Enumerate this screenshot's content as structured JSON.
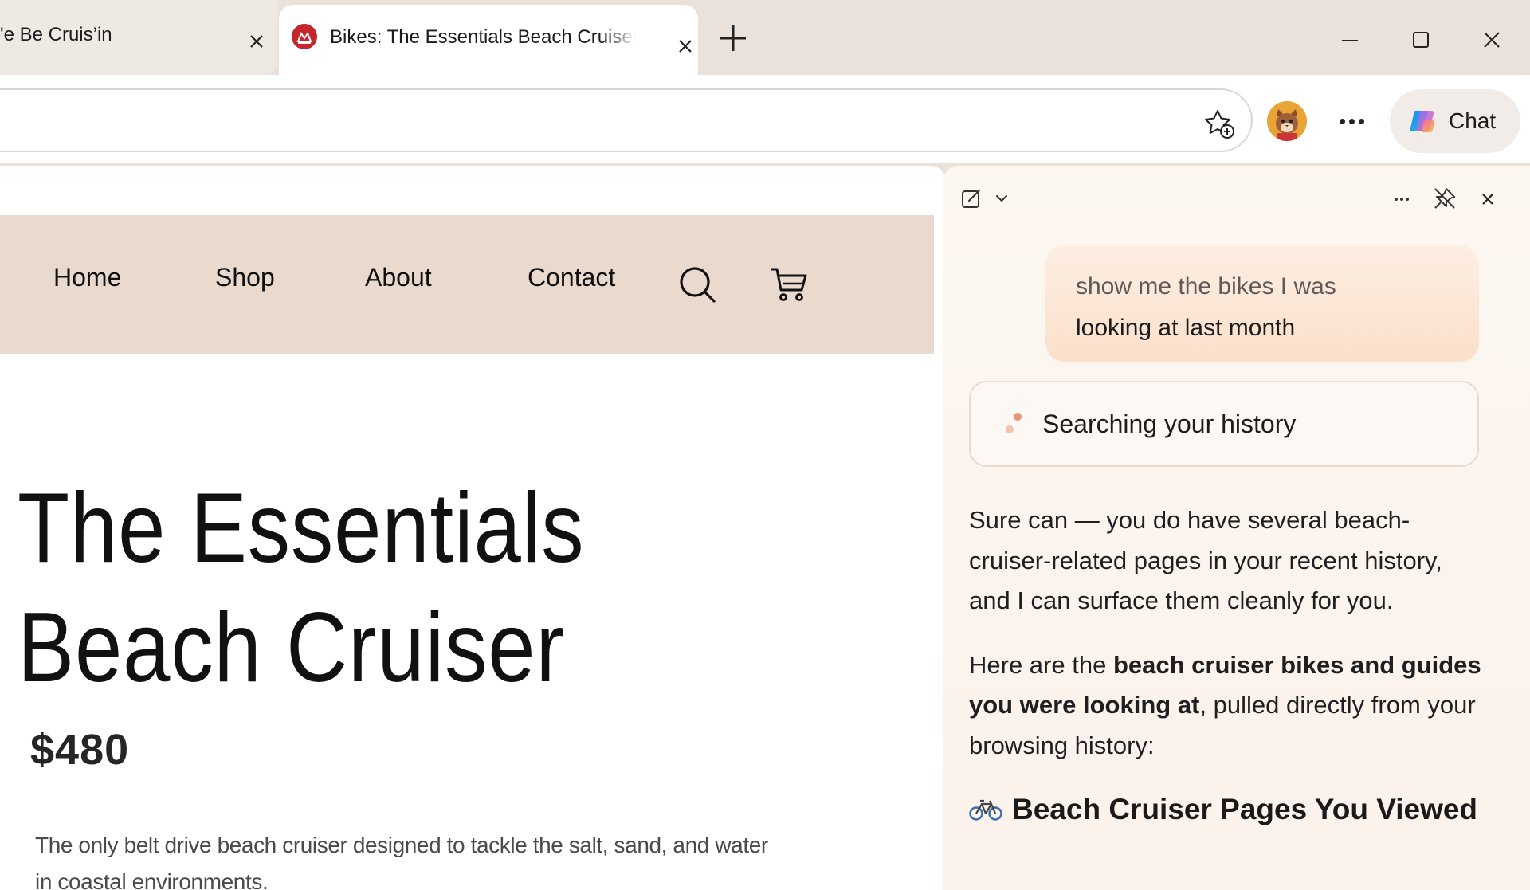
{
  "tabs": [
    {
      "title": "'e Be Cruis’in",
      "active": false
    },
    {
      "title": "Bikes: The Essentials Beach Cruiser",
      "active": true
    }
  ],
  "toolbar": {
    "chat_label": "Chat"
  },
  "webpage": {
    "nav": [
      "Home",
      "Shop",
      "About",
      "Contact"
    ],
    "product_title": "The Essentials Beach Cruiser",
    "price": "$480",
    "description": "The only belt drive beach cruiser designed to tackle the salt, sand, and water in coastal environments."
  },
  "copilot": {
    "user_message_line1": "show me the bikes I was",
    "user_message_line2": "looking at last month",
    "status": "Searching your history",
    "answer_p1": "Sure can — you do have several beach-cruiser-related pages in your recent history, and I can surface them cleanly for you.",
    "answer_p2_pre": "Here are the ",
    "answer_p2_bold": "beach cruiser bikes and guides you were looking at",
    "answer_p2_post": ", pulled directly from your browsing history:",
    "section_heading": "Beach Cruiser Pages You Viewed"
  },
  "colors": {
    "favicon": "#c4262b",
    "nav_bg": "#e9dacd",
    "user_bubble": "#fbe0cb",
    "accent_dot": "#e8927a"
  }
}
